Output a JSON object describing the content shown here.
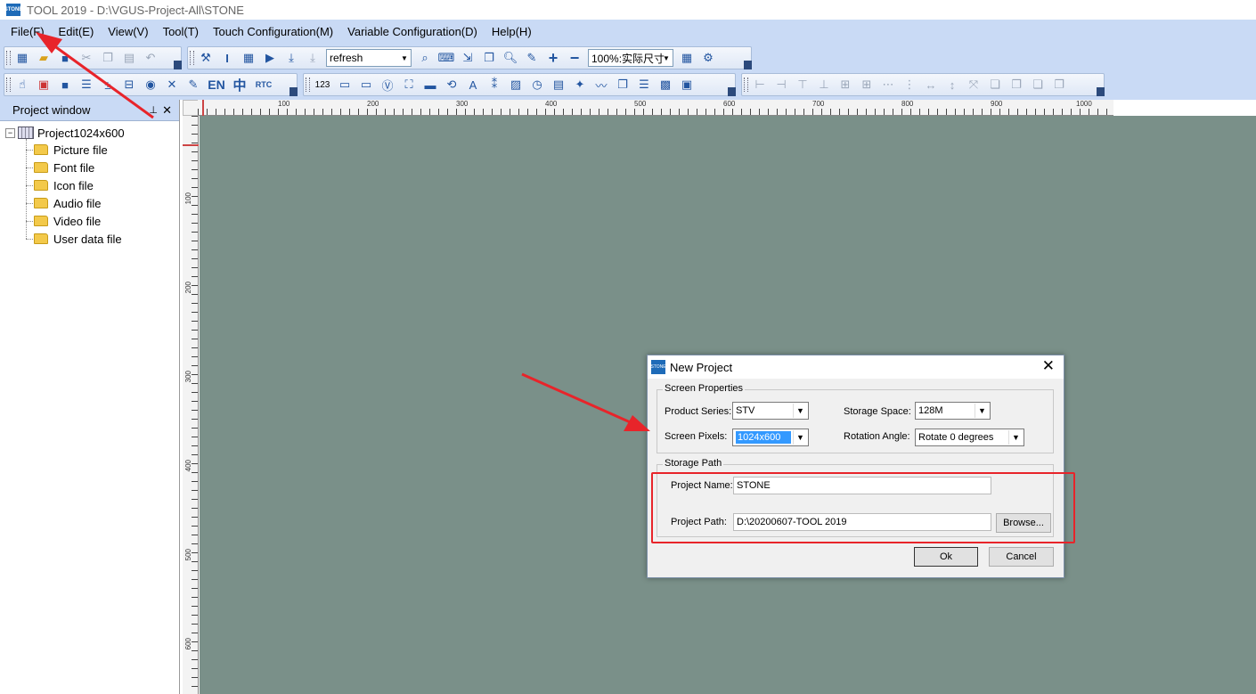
{
  "window": {
    "title": "TOOL 2019 - D:\\VGUS-Project-All\\STONE",
    "logo_text": "STONE"
  },
  "menu": [
    "File(F)",
    "Edit(E)",
    "View(V)",
    "Tool(T)",
    "Touch Configuration(M)",
    "Variable Configuration(D)",
    "Help(H)"
  ],
  "toolbar": {
    "refresh_combo": "refresh",
    "zoom_combo": "100%:实际尺寸",
    "text_buttons": {
      "en": "EN",
      "zh": "中",
      "rtc": "RTC",
      "num": "123"
    }
  },
  "project_window": {
    "title": "Project window",
    "root": "Project1024x600",
    "items": [
      "Picture file",
      "Font file",
      "Icon file",
      "Audio file",
      "Video file",
      "User data file"
    ]
  },
  "rulers": {
    "h_labels": [
      "100",
      "200",
      "300",
      "400",
      "500",
      "600",
      "700",
      "800",
      "900",
      "1000"
    ],
    "v_labels": [
      "100",
      "200",
      "300",
      "400",
      "500",
      "600"
    ]
  },
  "dialog": {
    "title": "New Project",
    "screen_properties": {
      "legend": "Screen Properties",
      "product_series_label": "Product Series:",
      "product_series_value": "STV",
      "storage_space_label": "Storage Space:",
      "storage_space_value": "128M",
      "screen_pixels_label": "Screen Pixels:",
      "screen_pixels_value": "1024x600",
      "rotation_label": "Rotation Angle:",
      "rotation_value": "Rotate 0 degrees"
    },
    "storage_path": {
      "legend": "Storage Path",
      "project_name_label": "Project Name:",
      "project_name_value": "STONE",
      "project_path_label": "Project Path:",
      "project_path_value": "D:\\20200607-TOOL 2019",
      "browse_label": "Browse..."
    },
    "ok_label": "Ok",
    "cancel_label": "Cancel"
  },
  "annotation_color": "#e8242a",
  "canvas_color": "#7a9089"
}
